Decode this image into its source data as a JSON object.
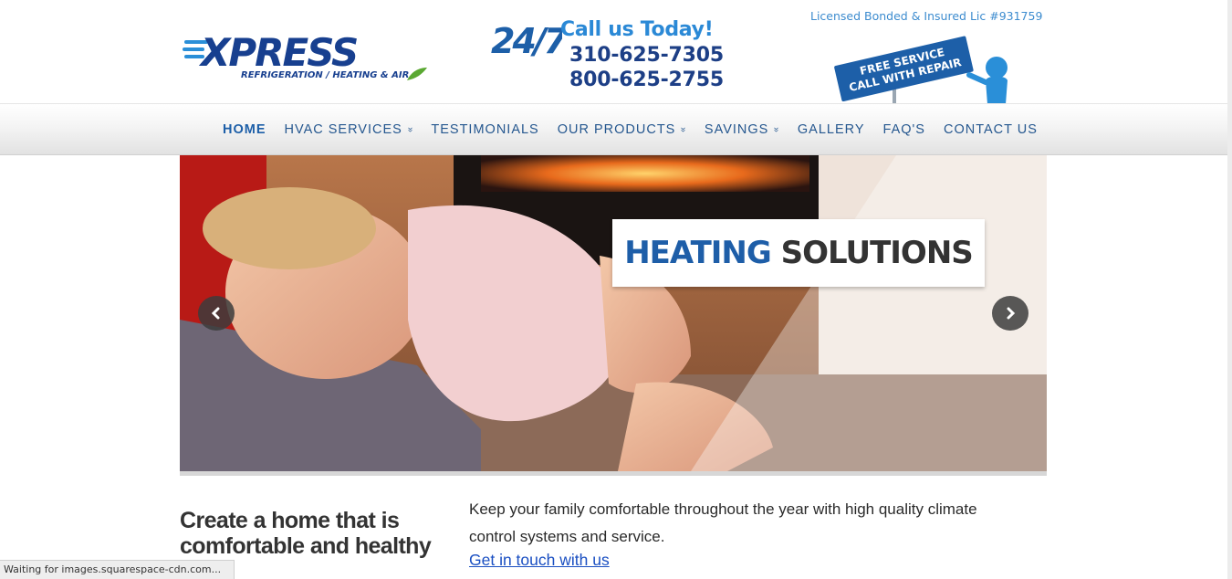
{
  "header": {
    "logo": {
      "brand": "XPRESS",
      "tagline": "REFRIGERATION / HEATING & AIR"
    },
    "call": {
      "badge": "24/7",
      "title": "Call us Today!",
      "phone_1": "310-625-7305",
      "phone_2": "800-625-2755"
    },
    "license": "Licensed Bonded & Insured Lic #931759",
    "sign": {
      "line_1": "FREE SERVICE",
      "line_2": "CALL WITH REPAIR"
    }
  },
  "nav": {
    "items": [
      {
        "label": "HOME",
        "active": true,
        "dropdown": false
      },
      {
        "label": "HVAC SERVICES",
        "active": false,
        "dropdown": true
      },
      {
        "label": "TESTIMONIALS",
        "active": false,
        "dropdown": false
      },
      {
        "label": "OUR PRODUCTS",
        "active": false,
        "dropdown": true
      },
      {
        "label": "SAVINGS",
        "active": false,
        "dropdown": true
      },
      {
        "label": "GALLERY",
        "active": false,
        "dropdown": false
      },
      {
        "label": "FAQ'S",
        "active": false,
        "dropdown": false
      },
      {
        "label": "CONTACT US",
        "active": false,
        "dropdown": false
      }
    ],
    "dropdown_glyph": "»"
  },
  "slider": {
    "caption_word_1": "HEATING",
    "caption_word_2": "SOLUTIONS",
    "prev_glyph": "‹",
    "next_glyph": "›"
  },
  "content": {
    "headline": "Create a home that is comfortable and healthy",
    "intro": "Keep your family comfortable throughout the year with high quality climate control systems and service.",
    "link": "Get in touch with us"
  },
  "status_bar": "Waiting for images.squarespace-cdn.com...",
  "colors": {
    "brand_blue": "#1d5fa8",
    "nav_text": "#25578f",
    "phone": "#1d3f86",
    "call_title": "#2b89d6",
    "link": "#1a4fc2"
  }
}
